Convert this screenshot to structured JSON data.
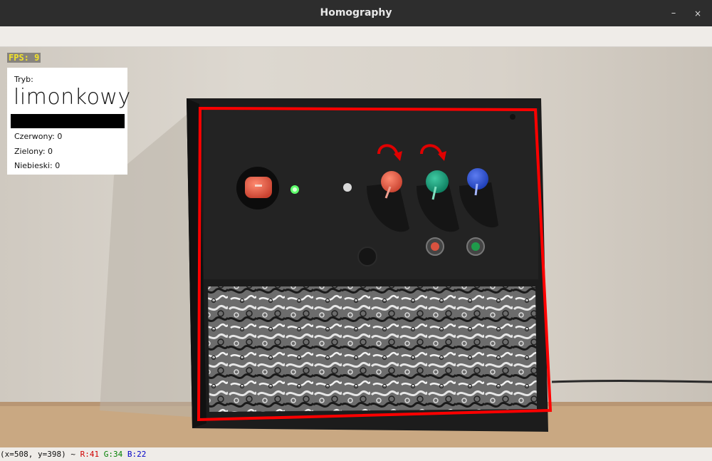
{
  "window": {
    "title": "Homography",
    "minimize_icon": "–",
    "close_icon": "×"
  },
  "overlay": {
    "fps": "FPS: 9",
    "mode_label": "Tryb:",
    "mode_value": "limonkowy",
    "swatch_color": "#000000",
    "red": "Czerwony: 0",
    "green": "Zielony: 0",
    "blue": "Niebieski: 0"
  },
  "colors": {
    "detection_outline": "#ff0000",
    "fps_text": "#f2e22a"
  },
  "status": {
    "coords": "(x=508, y=398) ~ ",
    "r": "R:41",
    "g": "G:34",
    "b": "B:22"
  }
}
